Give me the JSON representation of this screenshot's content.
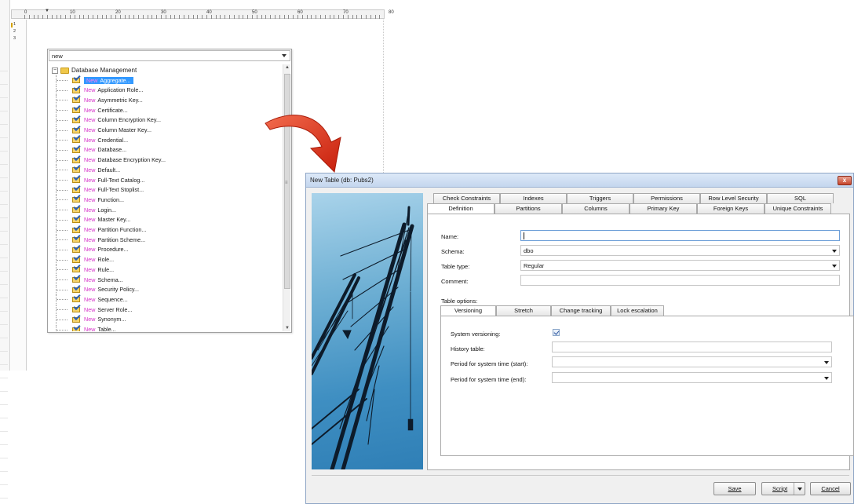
{
  "editor": {
    "ruler_numbers": [
      "0",
      "10",
      "20",
      "30",
      "40",
      "50",
      "60",
      "70",
      "80"
    ],
    "line_numbers": [
      "1",
      "2",
      "3"
    ]
  },
  "completion": {
    "input_value": "new",
    "root_label": "Database Management",
    "keyword": "New",
    "items": [
      "Aggregate...",
      "Application Role...",
      "Asymmetric Key...",
      "Certificate...",
      "Column Encryption Key...",
      "Column Master Key...",
      "Credential...",
      "Database...",
      "Database Encryption Key...",
      "Default...",
      "Full-Text Catalog...",
      "Full-Text Stoplist...",
      "Function...",
      "Login...",
      "Master Key...",
      "Partition Function...",
      "Partition Scheme...",
      "Procedure...",
      "Role...",
      "Rule...",
      "Schema...",
      "Security Policy...",
      "Sequence...",
      "Server Role...",
      "Synonym...",
      "Table..."
    ],
    "selected_index": 0
  },
  "dialog": {
    "title": "New Table (db: Pubs2)",
    "close_glyph": "x",
    "tabs_row1": [
      "Check Constraints",
      "Indexes",
      "Triggers",
      "Permissions",
      "Row Level Security",
      "SQL"
    ],
    "tabs_row2": [
      "Definition",
      "Partitions",
      "Columns",
      "Primary Key",
      "Foreign Keys",
      "Unique Constraints"
    ],
    "active_tab": "Definition",
    "form": {
      "name_label": "Name:",
      "name_value": "",
      "schema_label": "Schema:",
      "schema_value": "dbo",
      "table_type_label": "Table type:",
      "table_type_value": "Regular",
      "comment_label": "Comment:",
      "comment_value": ""
    },
    "table_options_label": "Table options:",
    "inner_tabs": [
      "Versioning",
      "Stretch",
      "Change tracking",
      "Lock escalation"
    ],
    "active_inner_tab": "Versioning",
    "versioning": {
      "system_versioning_label": "System versioning:",
      "system_versioning_checked": true,
      "history_table_label": "History table:",
      "history_table_value": "",
      "period_start_label": "Period for system time (start):",
      "period_start_value": "",
      "period_end_label": "Period for system time (end):",
      "period_end_value": ""
    },
    "buttons": {
      "save": "Save",
      "script": "Script",
      "cancel": "Cancel"
    }
  },
  "colors": {
    "keyword_new": "#d631c9",
    "selection": "#3399ff",
    "arrow": "#e0321c"
  }
}
